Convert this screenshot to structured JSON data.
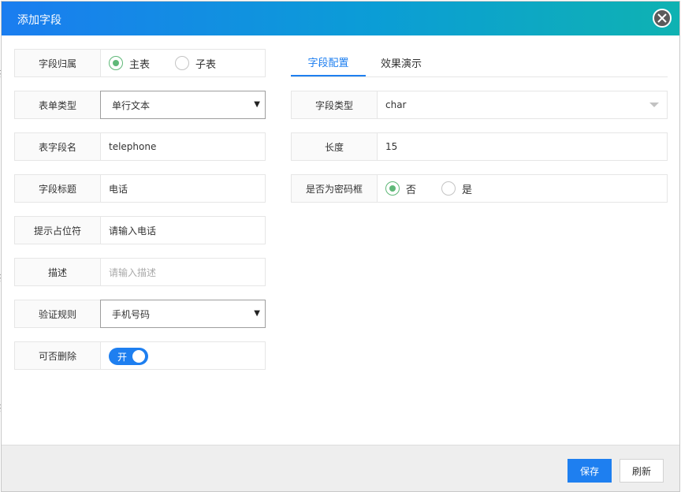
{
  "background": {
    "glyphs": [
      "提",
      "提",
      "提"
    ]
  },
  "dialog": {
    "title": "添加字段",
    "close_icon": "close-icon"
  },
  "left_form": {
    "field_owner": {
      "label": "字段归属",
      "options": [
        {
          "label": "主表",
          "checked": true
        },
        {
          "label": "子表",
          "checked": false
        }
      ]
    },
    "form_type": {
      "label": "表单类型",
      "value": "单行文本"
    },
    "table_field_name": {
      "label": "表字段名",
      "value": "telephone"
    },
    "field_title": {
      "label": "字段标题",
      "value": "电话"
    },
    "placeholder_text": {
      "label": "提示占位符",
      "value": "请输入电话"
    },
    "description": {
      "label": "描述",
      "placeholder": "请输入描述"
    },
    "validation_rule": {
      "label": "验证规则",
      "value": "手机号码"
    },
    "deletable": {
      "label": "可否删除",
      "switch_text": "开",
      "on": true
    }
  },
  "right_panel": {
    "tabs": [
      {
        "label": "字段配置",
        "active": true
      },
      {
        "label": "效果演示",
        "active": false
      }
    ],
    "field_type": {
      "label": "字段类型",
      "value": "char"
    },
    "length": {
      "label": "长度",
      "value": "15"
    },
    "is_password": {
      "label": "是否为密码框",
      "options": [
        {
          "label": "否",
          "checked": true
        },
        {
          "label": "是",
          "checked": false
        }
      ]
    }
  },
  "footer": {
    "save_label": "保存",
    "refresh_label": "刷新"
  },
  "colors": {
    "accent": "#1e7ff0",
    "radio_checked": "#5fb878",
    "title_gradient_start": "#1a7df0",
    "title_gradient_end": "#0fb2b2"
  }
}
